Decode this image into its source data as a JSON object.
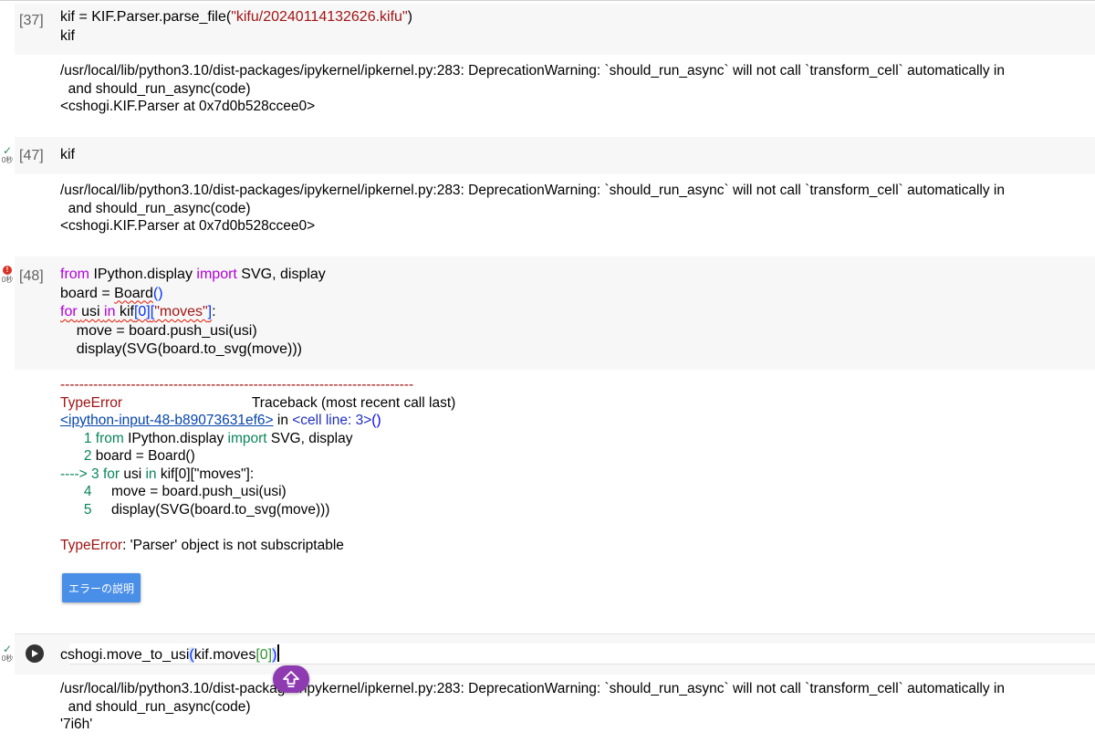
{
  "cell37": {
    "prompt": "[37]",
    "code_line1_pre": "kif = KIF.Parser.parse_file(",
    "code_line1_str": "\"kifu/20240114132626.kifu\"",
    "code_line1_post": ")",
    "code_line2": "kif",
    "output": "/usr/local/lib/python3.10/dist-packages/ipykernel/ipkernel.py:283: DeprecationWarning: `should_run_async` will not call `transform_cell` automatically in\n  and should_run_async(code)\n<cshogi.KIF.Parser at 0x7d0b528ccee0>"
  },
  "cell47": {
    "prompt": "[47]",
    "secs": "0秒",
    "code": "kif",
    "output": "/usr/local/lib/python3.10/dist-packages/ipykernel/ipkernel.py:283: DeprecationWarning: `should_run_async` will not call `transform_cell` automatically in\n  and should_run_async(code)\n<cshogi.KIF.Parser at 0x7d0b528ccee0>"
  },
  "cell48": {
    "prompt": "[48]",
    "secs": "0秒",
    "line1": {
      "from": "from",
      "mod": " IPython.display ",
      "imp": "import",
      "rest": " SVG, display"
    },
    "line2": {
      "pre": "board = ",
      "call": "Board",
      "paren": "()"
    },
    "line3": {
      "for": "for",
      "sp1": " ",
      "usi": "usi",
      "sp2": " ",
      "in": "in",
      "sp3": " ",
      "kif": "kif",
      "idx": "[0]",
      "b1": "[",
      "str": "\"moves\"",
      "b2": "]",
      "colon": ":"
    },
    "line4": "    move = board.push_usi(usi)",
    "line5": "    display(SVG(board.to_svg(move)))",
    "traceback": {
      "dashes": "---------------------------------------------------------------------------",
      "err_name": "TypeError",
      "tb_header": "Traceback (most recent call last)",
      "link": "<ipython-input-48-b89073631ef6>",
      "in_word": " in ",
      "cell_line": "<cell line: 3>",
      "cell_paren": "()",
      "l1_num": "      1 ",
      "l1_from": "from",
      "l1_mod": " IPython.display ",
      "l1_imp": "import",
      "l1_rest": " SVG, display",
      "l2_num": "      2 ",
      "l2_code": "board = Board()",
      "l3_arrow": "----> 3 ",
      "l3_for": "for",
      "l3_mid": " usi ",
      "l3_in": "in",
      "l3_rest": " kif[0][\"moves\"]:",
      "l4_num": "      4 ",
      "l4_code": "    move = board.push_usi(usi)",
      "l5_num": "      5 ",
      "l5_code": "    display(SVG(board.to_svg(move)))",
      "final_name": "TypeError",
      "final_msg": ": 'Parser' object is not subscriptable"
    },
    "explain_button": "エラーの説明"
  },
  "cell_active": {
    "secs": "0秒",
    "code_pre": "cshogi.move_to_usi",
    "paren_open": "(",
    "code_mid": "kif.moves",
    "idx": "[0]",
    "paren_close": ")",
    "output": "/usr/local/lib/python3.10/dist-packages/ipykernel/ipkernel.py:283: DeprecationWarning: `should_run_async` will not call `transform_cell` automatically in\n  and should_run_async(code)\n'7i6h'"
  },
  "icons": {
    "status_ok": "check-icon",
    "status_err": "error-icon",
    "run": "run-icon",
    "fab": "scroll-up-icon"
  },
  "colors": {
    "keyword": "#af00db",
    "string": "#a31515",
    "error_dot": "#d93025",
    "explain_button": "#4a8fe7",
    "fab": "#8e3ab0"
  }
}
